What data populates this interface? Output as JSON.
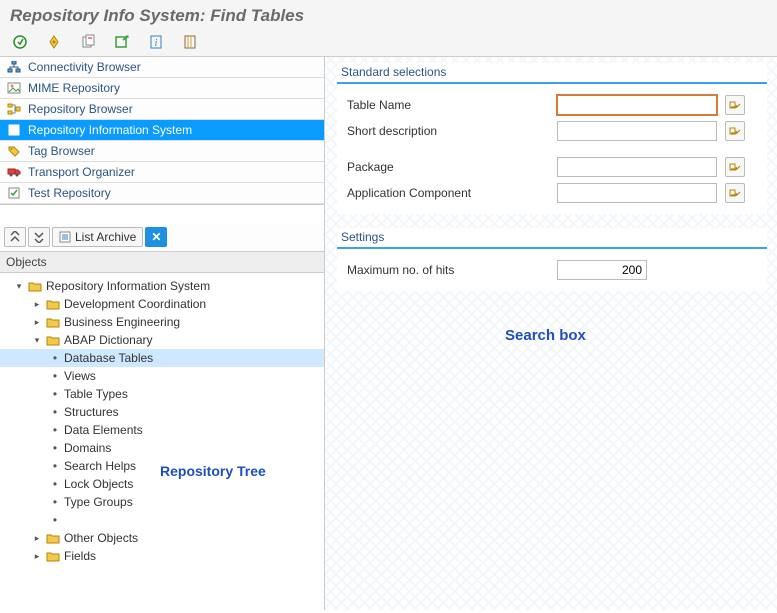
{
  "title": "Repository Info System: Find Tables",
  "nav": [
    {
      "label": "Connectivity Browser",
      "icon": "hierarchy"
    },
    {
      "label": "MIME Repository",
      "icon": "image"
    },
    {
      "label": "Repository Browser",
      "icon": "tree"
    },
    {
      "label": "Repository Information System",
      "icon": "info-doc",
      "selected": true
    },
    {
      "label": "Tag Browser",
      "icon": "tag"
    },
    {
      "label": "Transport Organizer",
      "icon": "truck"
    },
    {
      "label": "Test Repository",
      "icon": "test"
    }
  ],
  "midToolbar": {
    "listArchive": "List Archive"
  },
  "objectsHeader": "Objects",
  "tree": [
    {
      "d": 0,
      "t": "open",
      "icon": "folder",
      "label": "Repository Information System"
    },
    {
      "d": 1,
      "t": "closed",
      "icon": "folder",
      "label": "Development Coordination"
    },
    {
      "d": 1,
      "t": "closed",
      "icon": "folder",
      "label": "Business Engineering"
    },
    {
      "d": 1,
      "t": "open",
      "icon": "folder",
      "label": "ABAP Dictionary"
    },
    {
      "d": 2,
      "t": "leaf",
      "label": "Database Tables",
      "selected": true
    },
    {
      "d": 2,
      "t": "leaf",
      "label": "Views"
    },
    {
      "d": 2,
      "t": "leaf",
      "label": "Table Types"
    },
    {
      "d": 2,
      "t": "leaf",
      "label": "Structures"
    },
    {
      "d": 2,
      "t": "leaf",
      "label": "Data Elements"
    },
    {
      "d": 2,
      "t": "leaf",
      "label": "Domains"
    },
    {
      "d": 2,
      "t": "leaf",
      "label": "Search Helps"
    },
    {
      "d": 2,
      "t": "leaf",
      "label": "Lock Objects"
    },
    {
      "d": 2,
      "t": "leaf",
      "label": "Type Groups"
    },
    {
      "d": 2,
      "t": "leaf",
      "label": ""
    },
    {
      "d": 1,
      "t": "closed",
      "icon": "folder",
      "label": "Other Objects"
    },
    {
      "d": 1,
      "t": "closed",
      "icon": "folder",
      "label": "Fields"
    }
  ],
  "annotations": {
    "tree": "Repository Tree",
    "search": "Search box"
  },
  "groups": {
    "selections": {
      "title": "Standard selections",
      "rows": [
        {
          "label": "Table Name",
          "key": "tableName",
          "value": "",
          "focused": true,
          "more": true
        },
        {
          "label": "Short description",
          "key": "shortDesc",
          "value": "",
          "more": true
        },
        {
          "label": "",
          "key": "spacer",
          "spacer": true
        },
        {
          "label": "Package",
          "key": "package",
          "value": "",
          "more": true
        },
        {
          "label": "Application Component",
          "key": "appComp",
          "value": "",
          "more": true
        }
      ]
    },
    "settings": {
      "title": "Settings",
      "rows": [
        {
          "label": "Maximum no. of hits",
          "key": "maxHits",
          "value": "200",
          "num": true
        }
      ]
    }
  }
}
